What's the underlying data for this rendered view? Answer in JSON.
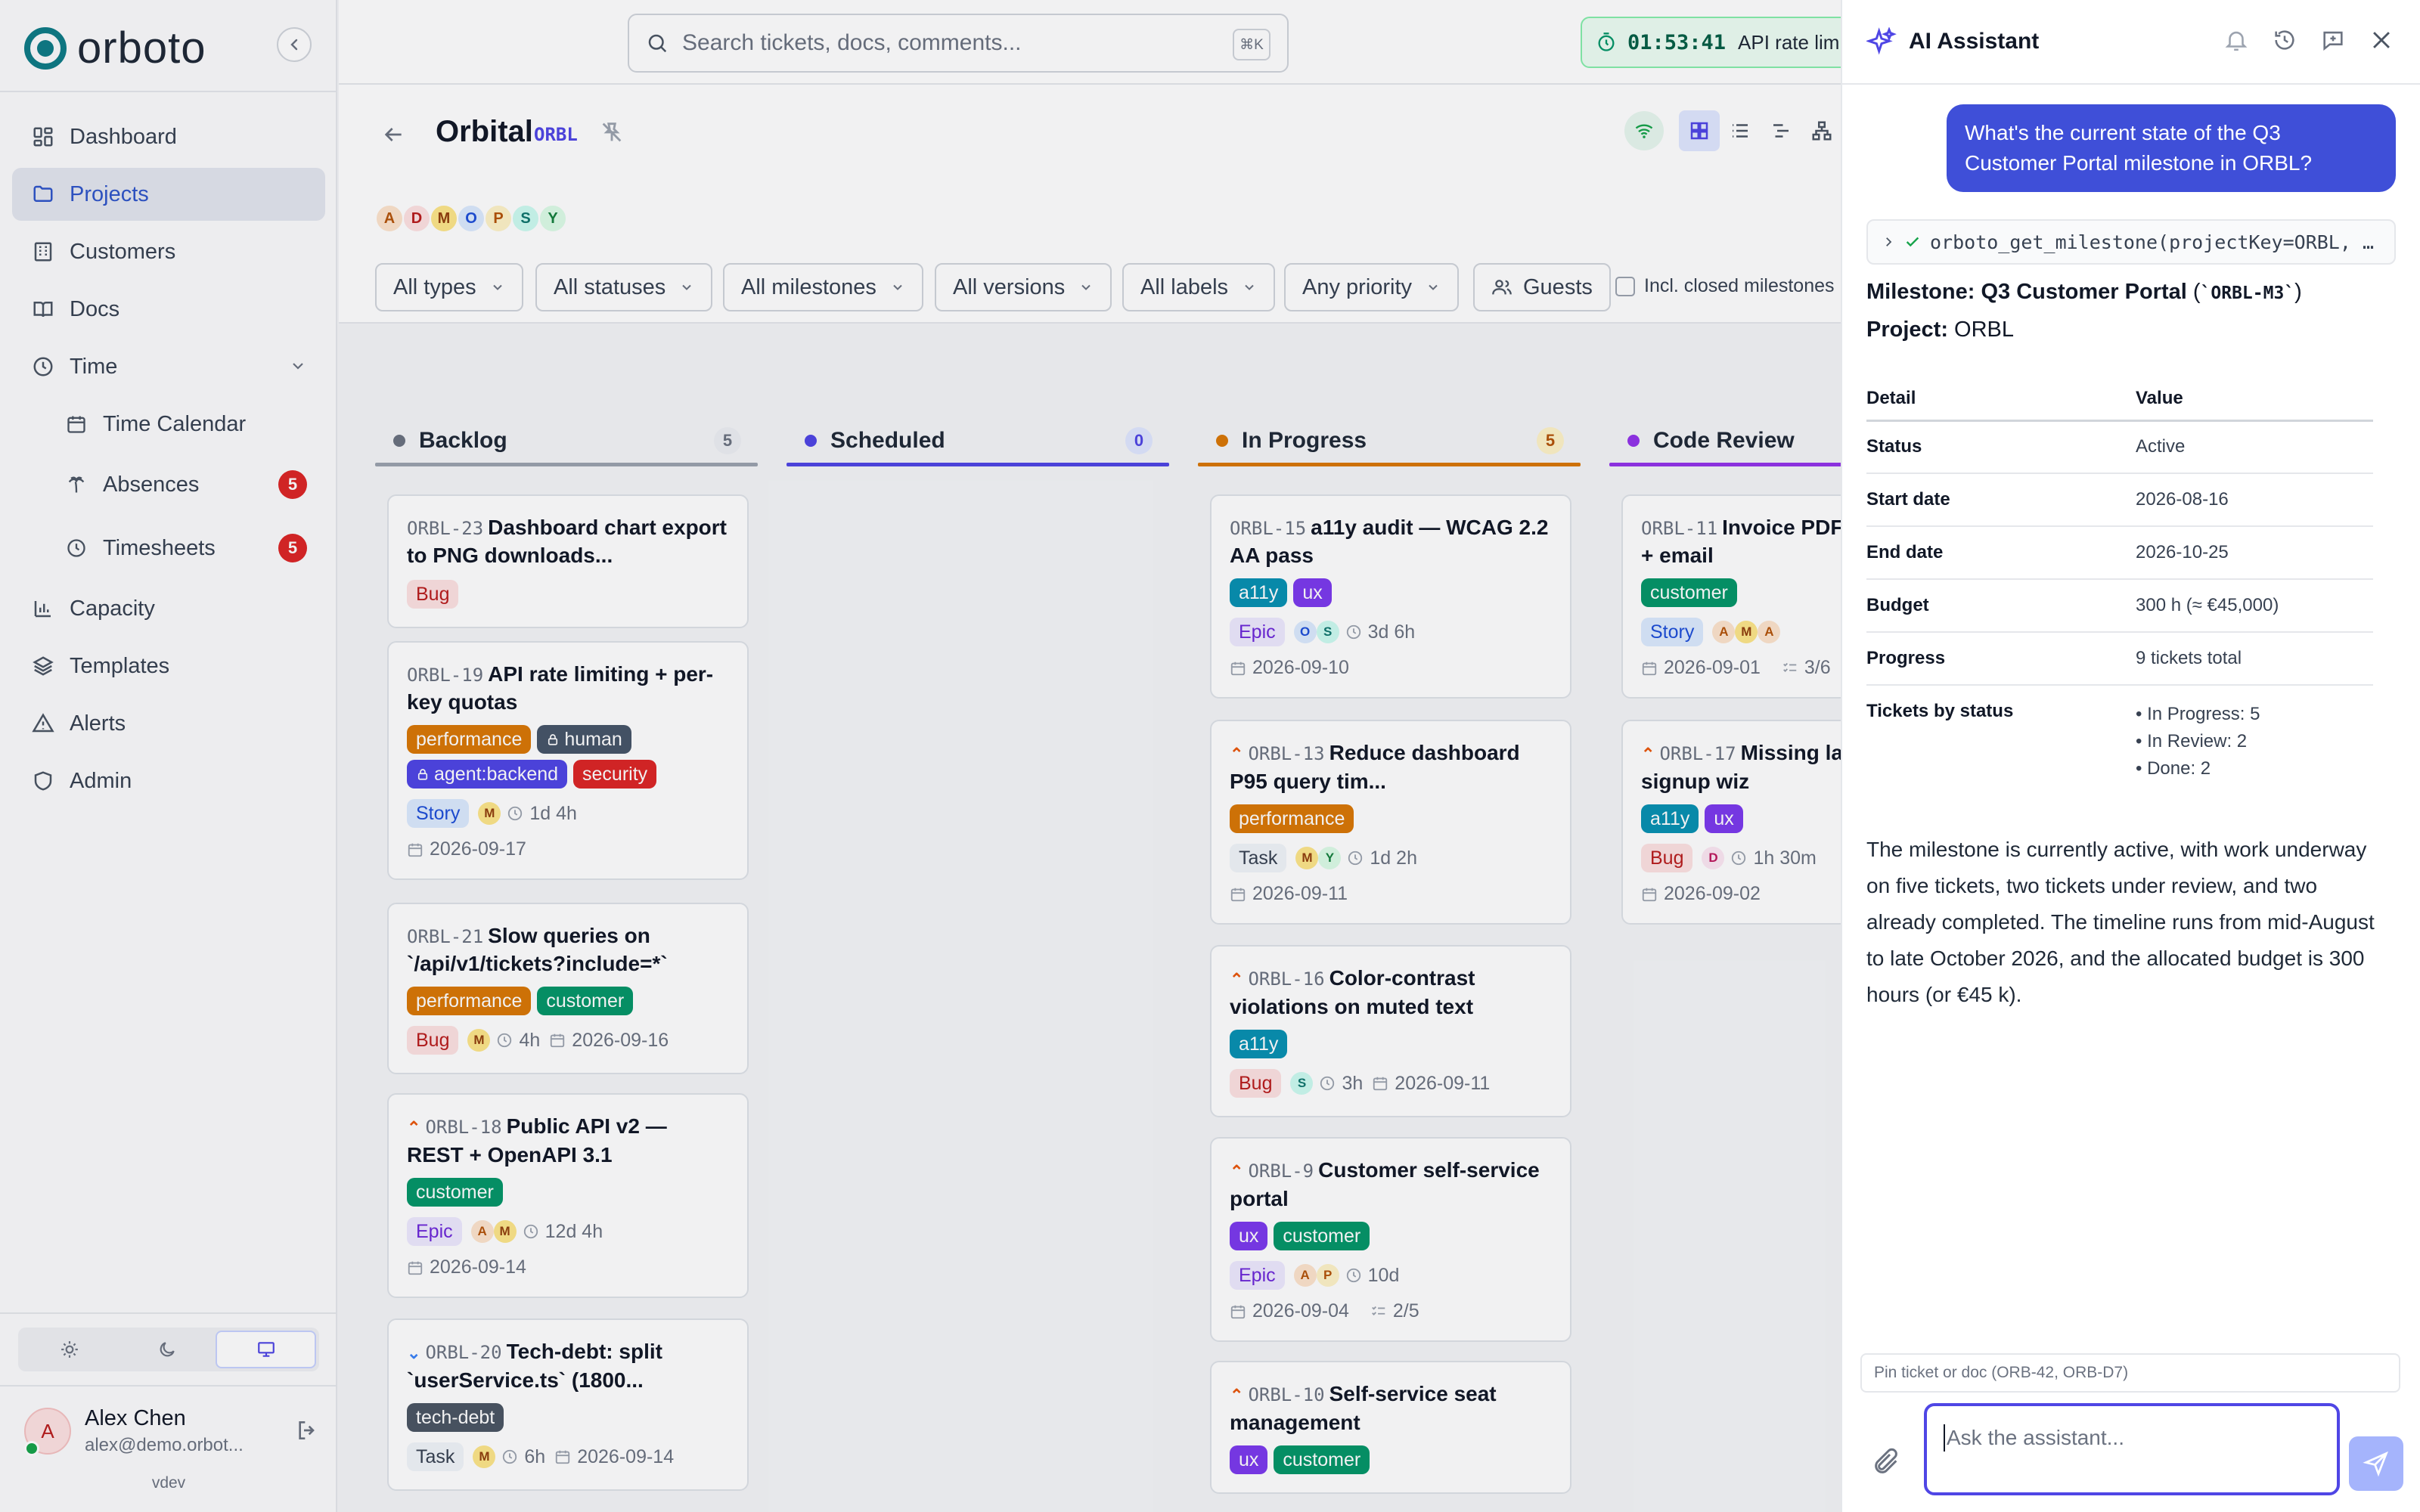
{
  "app": {
    "brand": "orboto"
  },
  "sidebar": {
    "items": [
      {
        "label": "Dashboard",
        "icon": "dashboard-icon"
      },
      {
        "label": "Projects",
        "icon": "folder-icon",
        "active": true
      },
      {
        "label": "Customers",
        "icon": "building-icon"
      },
      {
        "label": "Docs",
        "icon": "book-icon"
      },
      {
        "label": "Time",
        "icon": "clock-icon"
      },
      {
        "label": "Time Calendar",
        "icon": "calendar-icon"
      },
      {
        "label": "Absences",
        "icon": "palm-tree-icon",
        "badge": "5"
      },
      {
        "label": "Timesheets",
        "icon": "clock-icon",
        "badge": "5"
      },
      {
        "label": "Capacity",
        "icon": "bar-chart-icon"
      },
      {
        "label": "Templates",
        "icon": "layers-icon"
      },
      {
        "label": "Alerts",
        "icon": "alert-triangle-icon"
      },
      {
        "label": "Admin",
        "icon": "shield-icon"
      }
    ],
    "user": {
      "initial": "A",
      "name": "Alex Chen",
      "email": "alex@demo.orbot..."
    },
    "version": "vdev"
  },
  "topbar": {
    "search_placeholder": "Search tickets, docs, comments...",
    "search_shortcut": "⌘K",
    "timer_time": "01:53:41",
    "timer_label": "API rate limit"
  },
  "project": {
    "name": "Orbital",
    "key": "ORBL",
    "members": [
      "A",
      "D",
      "M",
      "O",
      "P",
      "S",
      "Y"
    ]
  },
  "filters": {
    "types": "All types",
    "statuses": "All statuses",
    "milestones": "All milestones",
    "versions": "All versions",
    "labels": "All labels",
    "priority": "Any priority",
    "guests": "Guests",
    "include_closed": "Incl. closed milestones"
  },
  "board": {
    "columns": [
      {
        "name": "Backlog",
        "count": "5",
        "color": "#6b7280",
        "cards": [
          {
            "key": "ORBL-23",
            "title": "Dashboard chart export to PNG downloads...",
            "labels": [],
            "type": "Bug",
            "assignees": [],
            "estimate": "",
            "due": ""
          },
          {
            "key": "ORBL-19",
            "title": "API rate limiting + per-key quotas",
            "labels": [
              "performance",
              "human",
              "agent:backend",
              "security"
            ],
            "type": "Story",
            "assignees": [
              "M"
            ],
            "estimate": "1d 4h",
            "due": "2026-09-17"
          },
          {
            "key": "ORBL-21",
            "title": "Slow queries on `/api/v1/tickets?include=*`",
            "labels": [
              "performance",
              "customer"
            ],
            "type": "Bug",
            "assignees": [
              "M"
            ],
            "estimate": "4h",
            "due": "2026-09-16"
          },
          {
            "key": "ORBL-18",
            "title": "Public API v2 — REST + OpenAPI 3.1",
            "labels": [
              "customer"
            ],
            "type": "Epic",
            "assignees": [
              "A",
              "M"
            ],
            "estimate": "12d 4h",
            "due": "2026-09-14"
          },
          {
            "key": "ORBL-20",
            "title": "Tech-debt: split `userService.ts` (1800...",
            "labels": [
              "tech-debt"
            ],
            "type": "Task",
            "assignees": [
              "M"
            ],
            "estimate": "6h",
            "due": "2026-09-14"
          }
        ]
      },
      {
        "name": "Scheduled",
        "count": "0",
        "color": "#4f46e5",
        "cards": []
      },
      {
        "name": "In Progress",
        "count": "5",
        "color": "#d97706",
        "cards": [
          {
            "key": "ORBL-15",
            "title": "a11y audit — WCAG 2.2 AA pass",
            "labels": [
              "a11y",
              "ux"
            ],
            "type": "Epic",
            "assignees": [
              "O",
              "S"
            ],
            "estimate": "3d 6h",
            "due": "2026-09-10"
          },
          {
            "key": "ORBL-13",
            "title": "Reduce dashboard P95 query tim...",
            "labels": [
              "performance"
            ],
            "type": "Task",
            "assignees": [
              "M",
              "Y"
            ],
            "estimate": "1d 2h",
            "due": "2026-09-11"
          },
          {
            "key": "ORBL-16",
            "title": "Color-contrast violations on muted text",
            "labels": [
              "a11y"
            ],
            "type": "Bug",
            "assignees": [
              "S"
            ],
            "estimate": "3h",
            "due": "2026-09-11"
          },
          {
            "key": "ORBL-9",
            "title": "Customer self-service portal",
            "labels": [
              "ux",
              "customer"
            ],
            "type": "Epic",
            "assignees": [
              "A",
              "P"
            ],
            "estimate": "10d",
            "due": "2026-09-04",
            "subtasks": "2/5"
          },
          {
            "key": "ORBL-10",
            "title": "Self-service seat management",
            "labels": [
              "ux",
              "customer"
            ]
          }
        ]
      },
      {
        "name": "Code Review",
        "count": "",
        "color": "#9333ea",
        "cards": [
          {
            "key": "ORBL-11",
            "title": "Invoice PDF download + email",
            "labels": [
              "customer"
            ],
            "type": "Story",
            "assignees": [
              "A",
              "M",
              "A"
            ],
            "due": "2026-09-01",
            "subtasks": "3/6"
          },
          {
            "key": "ORBL-17",
            "title": "Missing labels on signup wiz",
            "labels": [
              "a11y",
              "ux"
            ],
            "type": "Bug",
            "assignees": [
              "D"
            ],
            "estimate": "1h 30m",
            "due": "2026-09-02"
          }
        ]
      }
    ]
  },
  "assistant": {
    "title": "AI Assistant",
    "user_message": "What's the current state of the Q3 Customer Portal milestone in ORBL?",
    "tool_call": "orboto_get_milestone(projectKey=ORBL, mi...",
    "milestone_label": "Milestone:",
    "milestone_name": "Q3 Customer Portal",
    "milestone_code": "`ORBL-M3`",
    "project_label": "Project:",
    "project_value": "ORBL",
    "table": {
      "headers": [
        "Detail",
        "Value"
      ],
      "rows": [
        [
          "Status",
          "Active"
        ],
        [
          "Start date",
          "2026-08-16"
        ],
        [
          "End date",
          "2026-10-25"
        ],
        [
          "Budget",
          "300 h (≈ €45,000)"
        ],
        [
          "Progress",
          "9 tickets total"
        ]
      ],
      "tickets_by_status_label": "Tickets by status",
      "tickets_by_status": [
        "In Progress: 5",
        "In Review: 2",
        "Done: 2"
      ]
    },
    "summary": "The milestone is currently active, with work underway on five tickets, two tickets under review, and two already completed. The timeline runs from mid-August to late October 2026, and the allocated budget is 300 hours (or €45 k).",
    "pin_placeholder": "Pin ticket or doc (ORB-42, ORB-D7)",
    "ask_placeholder": "Ask the assistant..."
  }
}
